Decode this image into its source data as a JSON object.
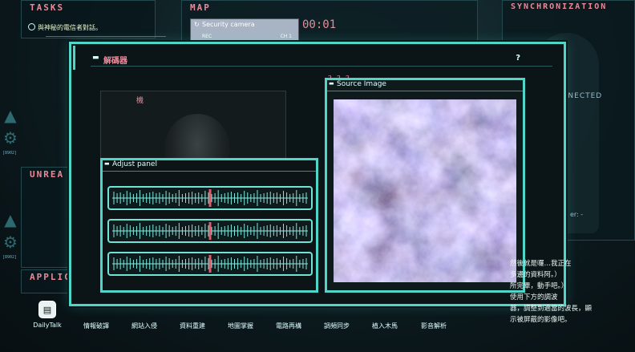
{
  "tasks": {
    "title": "TASKS",
    "item": "與神秘的電信者對話。"
  },
  "map": {
    "title": "MAP",
    "camera_label": "Security camera",
    "timer": "00:01",
    "rec": "REC",
    "channel": "CH 1"
  },
  "sync": {
    "title": "SYNCHRONIZATION",
    "status": "DISCONNECTED",
    "field": "er: -"
  },
  "unread": {
    "title": "UNREA"
  },
  "applications": {
    "title": "APPLIC"
  },
  "sidebar_code": "[8902]",
  "decoder": {
    "title": "解碼器",
    "help": "?",
    "figure_tag": "機",
    "question_marks": "？？？",
    "adjust_panel_title": "Adjust panel",
    "source_title": "Source Image"
  },
  "taskbar": [
    {
      "label": "DailyTalk",
      "icon": "chat-icon",
      "active": true
    },
    {
      "label": "情報破譯",
      "icon": "decode-icon",
      "active": false
    },
    {
      "label": "網站入侵",
      "icon": "web-icon",
      "active": false
    },
    {
      "label": "資料重建",
      "icon": "data-icon",
      "active": false
    },
    {
      "label": "地圖掌握",
      "icon": "map-icon",
      "active": false
    },
    {
      "label": "電路再構",
      "icon": "circuit-icon",
      "active": false
    },
    {
      "label": "調頻同步",
      "icon": "frequency-icon",
      "active": false
    },
    {
      "label": "植入木馬",
      "icon": "trojan-icon",
      "active": false
    },
    {
      "label": "影音解析",
      "icon": "media-icon",
      "active": false
    }
  ],
  "side_text": {
    "line1": "然後就是囉…我正在",
    "line2": "多邊的資料阿。）",
    "line3": "所完畢，動手吧。）",
    "line4": "使用下方的調波",
    "line5": "器，調整到適當的波長，顯",
    "line6": "示被屏蔽的影像吧。"
  },
  "sliders": [
    {
      "level": 0.5
    },
    {
      "level": 0.5
    },
    {
      "level": 0.5
    }
  ],
  "colors": {
    "accent": "#4fd6c8",
    "title_pink": "#e88a98",
    "marker": "#e05a6a"
  }
}
